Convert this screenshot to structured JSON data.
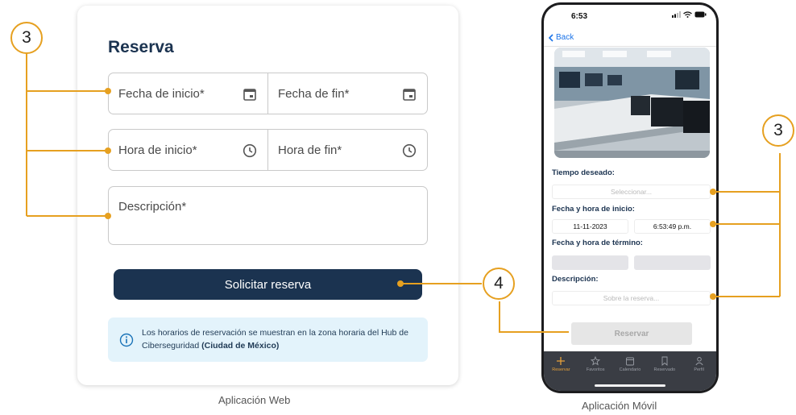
{
  "web": {
    "title": "Reserva",
    "fields": {
      "start_date": "Fecha de inicio",
      "end_date": "Fecha de fin",
      "start_time": "Hora de inicio",
      "end_time": "Hora de fin",
      "description": "Descripción",
      "required_mark": "*"
    },
    "submit_label": "Solicitar reserva",
    "info": {
      "text": "Los horarios de reservación se muestran en la zona horaria del Hub de Ciberseguridad",
      "bold": "(Ciudad de México)"
    },
    "caption": "Aplicación Web"
  },
  "mobile": {
    "status_time": "6:53",
    "back_label": "Back",
    "desired_time_label": "Tiempo deseado:",
    "desired_time_placeholder": "Seleccionar...",
    "start_label": "Fecha y hora de inicio:",
    "start_date_value": "11-11-2023",
    "start_time_value": "6:53:49 p.m.",
    "end_label": "Fecha y hora de término:",
    "description_label": "Descripción:",
    "description_placeholder": "Sobre la reserva...",
    "submit_label": "Reservar",
    "tabs": [
      {
        "label": "Reservar",
        "icon": "plus-icon"
      },
      {
        "label": "Favoritos",
        "icon": "star-icon"
      },
      {
        "label": "Calendario",
        "icon": "calendar-icon"
      },
      {
        "label": "Reservado",
        "icon": "bookmark-icon"
      },
      {
        "label": "Perfil",
        "icon": "person-icon"
      }
    ],
    "caption": "Aplicación Móvil"
  },
  "callouts": {
    "badge_left": "3",
    "badge_center": "4",
    "badge_right": "3"
  },
  "colors": {
    "accent": "#e6a020",
    "navy": "#1b3350",
    "info_bg": "#e3f3fb",
    "tab_active": "#e7a13a",
    "tabbar_bg": "#3a3d44"
  }
}
